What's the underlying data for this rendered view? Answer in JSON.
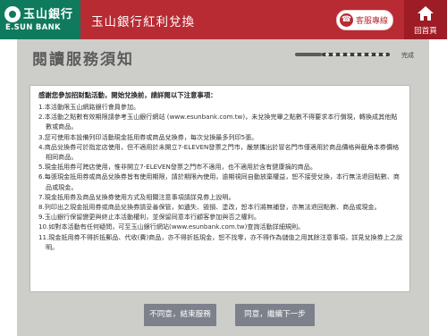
{
  "header": {
    "logo_cn": "玉山銀行",
    "logo_en": "E.SUN BANK",
    "app_title": "玉山銀行紅利兌換",
    "service_label": "客服專線",
    "home_label": "回首頁"
  },
  "page": {
    "title": "閱讀服務須知",
    "progress_label": "完成",
    "progress_fraction": 0.25
  },
  "notice": {
    "header": "感謝您參加招財點活動，開始兌換前，請詳閱以下注意事項：",
    "items": [
      "1.本活動限玉山網路銀行會員參加。",
      "2.本活動之點數有效期限請參考玉山銀行網站 (www.esunbank.com.tw)，未兌換完畢之點數不得要求本行償現，轉換成其他點數或商品。",
      "3.您可使用本設備列印活動現金抵用券或商品兌換券，每次兌換最多列印5張。",
      "4.商品兌換券可於指定店使用，但不適用於未開立7-ELEVEN發票之門市，嚴禁攜出於冒名門市僅適用於商品價格與截角本券價格相同商品。",
      "5.現金抵用券可跨店使用，惟非開立7-ELEVEN發票之門市不適用，也不適用於含有健康捐的商品。",
      "6.每張現金抵用券或商品兌換券皆有使用期限，請於期限內使用，逾期視同自動放棄權益，恕不接受兌換，本行無法退回點數、商品或現金。",
      "7.現金抵用券及商品兌換券使用方式及相關注意事項請詳見券上說明。",
      "8.列印出之現金抵用券或商品兌換券請妥善保管，如遺失、毀損、塗改，恕本行將無補發，亦無法退回點數、商品或現金。",
      "9.玉山銀行保留變更與終止本活動權利，並保留同意本行顧客參加與否之權利。",
      "10.如對本活動有任何疑問，可至玉山銀行網站(www.esunbank.com.tw)查詢活動詳細規則。",
      "11.現金抵用券不得折抵郵品、代收(費)商品，亦不得折抵現金，恕不找零，亦不得作為儲值之用其餘注意事項，詳見兌換券上之說明。"
    ]
  },
  "buttons": {
    "disagree": "不同意，結束服務",
    "agree": "同意，繼續下一步"
  },
  "colors": {
    "brand_green": "#0f7a5d",
    "brand_red": "#b82b33",
    "home_red": "#9e1c25",
    "panel_gray": "#cdcdc9",
    "button_gray": "#7d818b"
  },
  "icons": {
    "logo": "esun-logo-icon",
    "service": "phone-icon",
    "home": "home-icon"
  }
}
